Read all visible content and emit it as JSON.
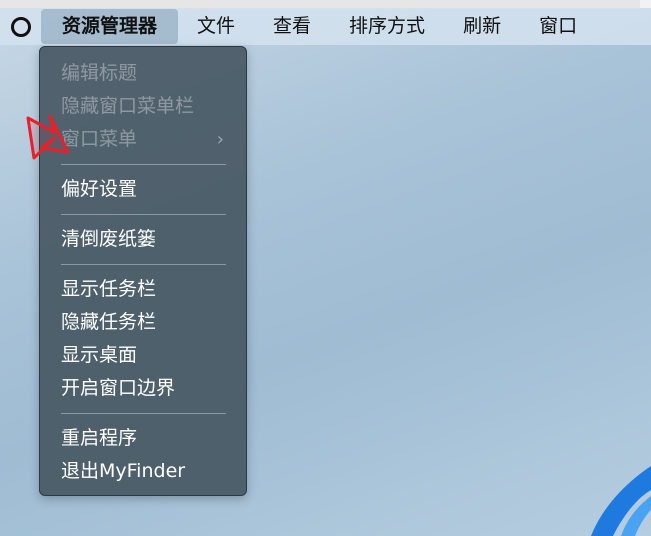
{
  "menubar": {
    "items": [
      {
        "label": "资源管理器",
        "active": true
      },
      {
        "label": "文件"
      },
      {
        "label": "查看"
      },
      {
        "label": "排序方式"
      },
      {
        "label": "刷新"
      },
      {
        "label": "窗口"
      }
    ]
  },
  "dropdown": {
    "groups": [
      [
        {
          "label": "编辑标题",
          "disabled": true
        },
        {
          "label": "隐藏窗口菜单栏",
          "disabled": true
        },
        {
          "label": "窗口菜单",
          "disabled": true,
          "submenu_indicator": "›"
        }
      ],
      [
        {
          "label": "偏好设置"
        }
      ],
      [
        {
          "label": "清倒废纸篓"
        }
      ],
      [
        {
          "label": "显示任务栏"
        },
        {
          "label": "隐藏任务栏"
        },
        {
          "label": "显示桌面"
        },
        {
          "label": "开启窗口边界"
        }
      ],
      [
        {
          "label": "重启程序"
        },
        {
          "label": "退出MyFinder"
        }
      ]
    ]
  },
  "icons": {
    "menu_logo": "circle-logo-icon",
    "annotation": "red-arrow-icon",
    "wallpaper": "blue-swirl-icon"
  },
  "colors": {
    "menu_bg": "#d4e2ee",
    "dropdown_bg": "#485864",
    "arrow_stroke": "#e8202a",
    "swirl": "#1f7ae0"
  }
}
